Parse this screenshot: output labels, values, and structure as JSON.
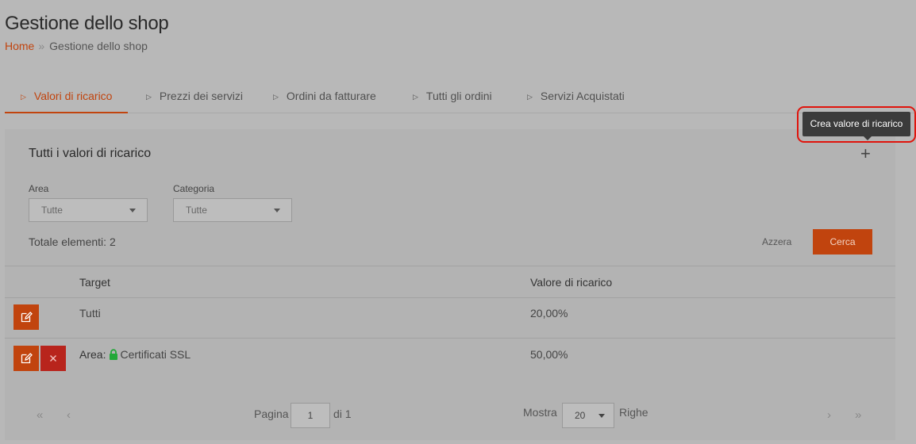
{
  "page": {
    "title": "Gestione dello shop"
  },
  "breadcrumb": {
    "home": "Home",
    "separator": "»",
    "current": "Gestione dello shop"
  },
  "tabs": [
    {
      "label": "Valori di ricarico",
      "active": true
    },
    {
      "label": "Prezzi dei servizi",
      "active": false
    },
    {
      "label": "Ordini da fatturare",
      "active": false
    },
    {
      "label": "Tutti gli ordini",
      "active": false
    },
    {
      "label": "Servizi Acquistati",
      "active": false
    }
  ],
  "tooltip": {
    "text": "Crea valore di ricarico"
  },
  "panel": {
    "title": "Tutti i valori di ricarico",
    "add_icon": "+",
    "filters": {
      "area": {
        "label": "Area",
        "value": "Tutte"
      },
      "categoria": {
        "label": "Categoria",
        "value": "Tutte"
      }
    },
    "total": "Totale elementi: 2",
    "reset_label": "Azzera",
    "search_label": "Cerca"
  },
  "table": {
    "columns": [
      "Target",
      "Valore di ricarico"
    ],
    "rows": [
      {
        "target": "Tutti",
        "value": "20,00%",
        "actions": [
          "edit"
        ]
      },
      {
        "target_prefix": "Area:",
        "target": "Certificati SSL",
        "target_icon": "lock-icon",
        "value": "50,00%",
        "actions": [
          "edit",
          "delete"
        ]
      }
    ]
  },
  "pagination": {
    "first": "«",
    "prev": "‹",
    "next": "›",
    "last": "»",
    "page_label": "Pagina",
    "page_value": "1",
    "of_label": "di 1",
    "show_label": "Mostra",
    "rows_value": "20",
    "rows_label": "Righe"
  },
  "colors": {
    "accent": "#c1440e",
    "delete": "#b8241c",
    "lock": "#22a838",
    "highlight": "#e0140c"
  }
}
